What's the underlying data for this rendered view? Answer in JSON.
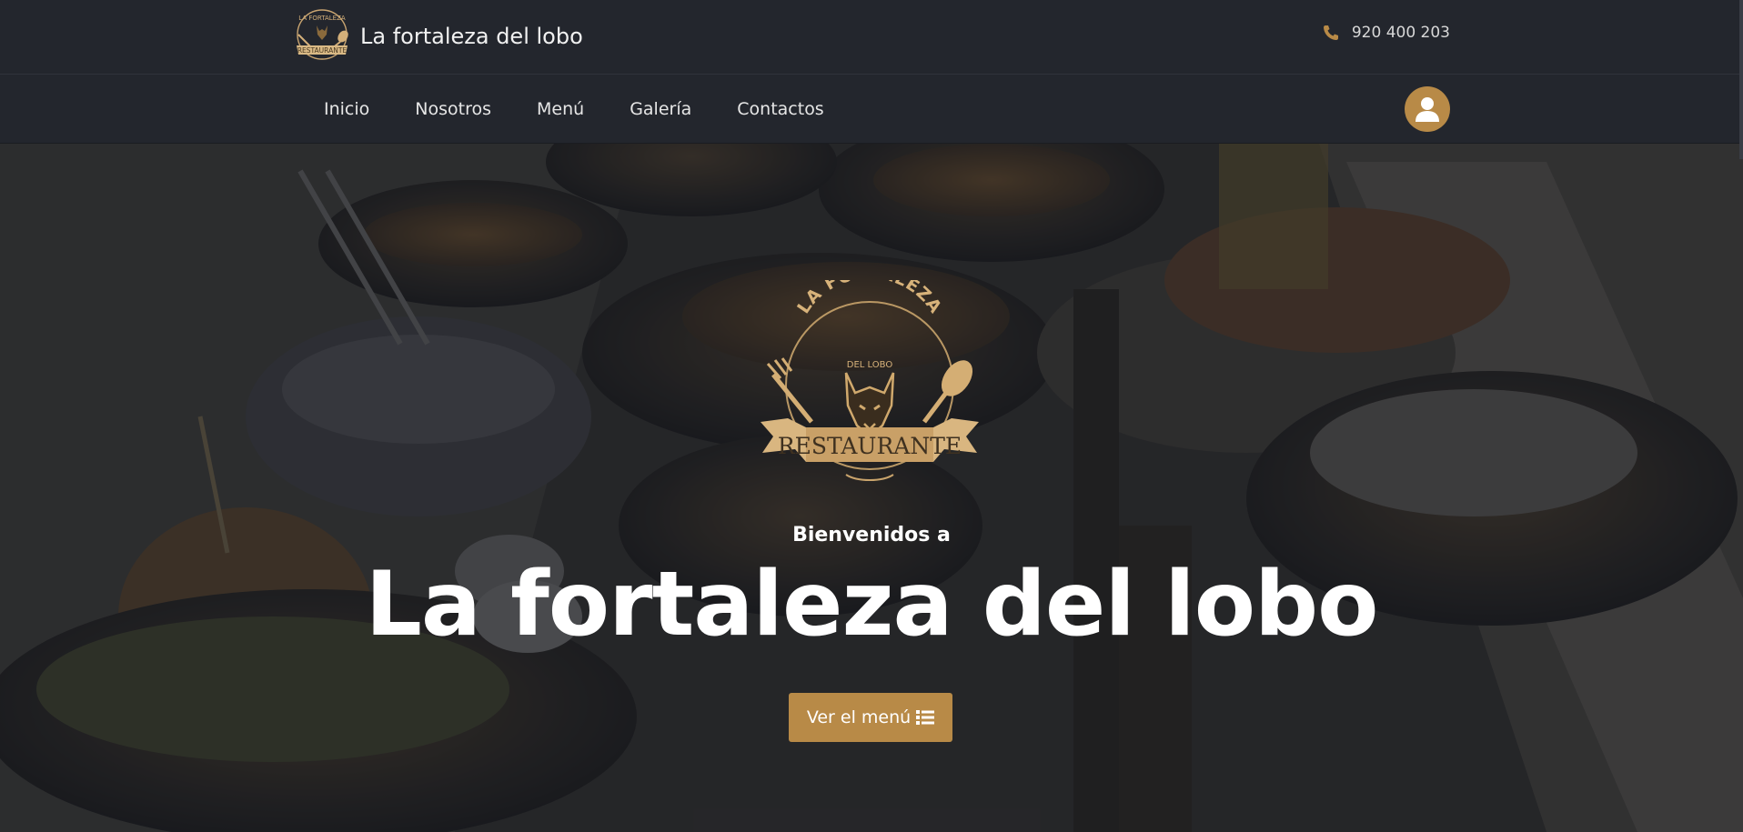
{
  "header": {
    "brand_name": "La fortaleza del lobo",
    "phone": "920 400 203",
    "logo_icon": "wolf-restaurant-logo-icon",
    "phone_icon": "phone-icon"
  },
  "nav": {
    "items": [
      {
        "label": "Inicio"
      },
      {
        "label": "Nosotros"
      },
      {
        "label": "Menú"
      },
      {
        "label": "Galería"
      },
      {
        "label": "Contactos"
      }
    ],
    "user_icon": "user-icon"
  },
  "hero": {
    "subtitle": "Bienvenidos a",
    "title": "La fortaleza del lobo",
    "button_label": "Ver el menú",
    "button_icon": "list-icon",
    "logo_text_top": "LA FORTALEZA",
    "logo_text_mid": "DEL LOBO",
    "logo_banner": "RESTAURANTE"
  },
  "colors": {
    "accent": "#b88a47",
    "header_bg": "#23262d",
    "text": "#ffffff"
  }
}
